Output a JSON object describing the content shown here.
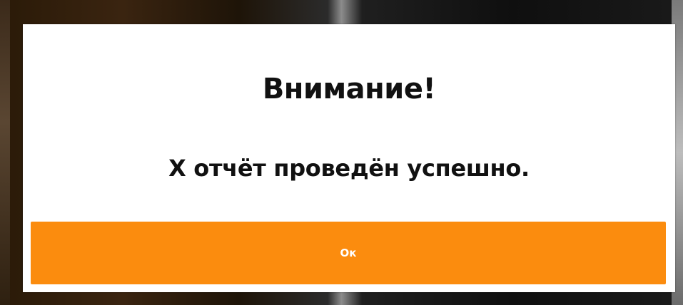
{
  "dialog": {
    "title": "Внимание!",
    "message": "Х отчёт проведён успешно.",
    "ok_label": "Ок"
  },
  "colors": {
    "accent": "#fb8c0e",
    "dialog_background": "#ffffff",
    "text": "#111111"
  }
}
